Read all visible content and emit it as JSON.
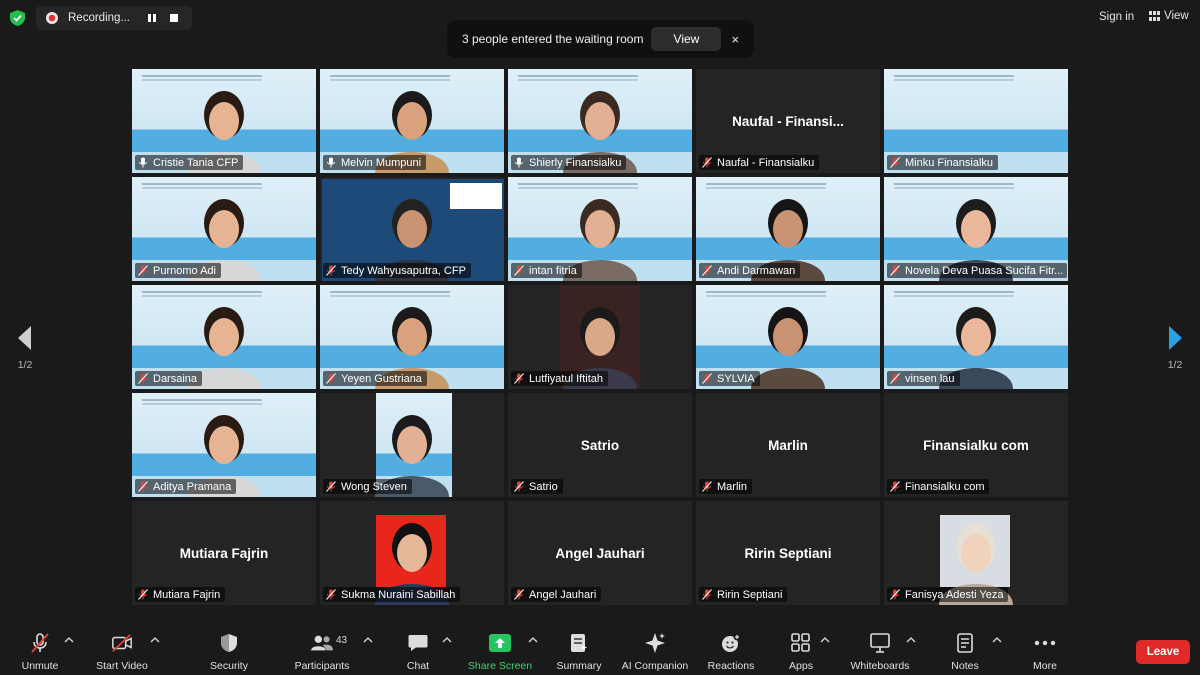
{
  "recording": {
    "label": "Recording..."
  },
  "header": {
    "signin": "Sign in",
    "view": "View"
  },
  "notification": {
    "text": "3 people entered the waiting room",
    "view_button": "View",
    "close": "×"
  },
  "pager": {
    "left": "1/2",
    "right": "1/2"
  },
  "participants": [
    {
      "name": "Cristie Tania CFP",
      "muted": false,
      "video": "slide-person",
      "active": true
    },
    {
      "name": "Melvin Mumpuni",
      "muted": false,
      "video": "slide-person"
    },
    {
      "name": "Shierly Finansialku",
      "muted": false,
      "video": "slide-person"
    },
    {
      "name": "Naufal - Finansialku",
      "muted": true,
      "video": "off",
      "center_name": "Naufal - Finansi..."
    },
    {
      "name": "Minku Finansialku",
      "muted": true,
      "video": "slide"
    },
    {
      "name": "Purnomo Adi",
      "muted": true,
      "video": "slide-person"
    },
    {
      "name": "Tedy Wahyusaputra, CFP",
      "muted": true,
      "video": "fpsb"
    },
    {
      "name": "intan fitria",
      "muted": true,
      "video": "slide-person"
    },
    {
      "name": "Andi Darmawan",
      "muted": true,
      "video": "slide-person"
    },
    {
      "name": "Novela Deva Puasa Sucifa Fitr...",
      "muted": true,
      "video": "slide-avatar"
    },
    {
      "name": "Darsaina",
      "muted": true,
      "video": "slide-avatar"
    },
    {
      "name": "Yeyen Gustriana",
      "muted": true,
      "video": "slide-person"
    },
    {
      "name": "Lutfiyatul Iftitah",
      "muted": true,
      "video": "photo-dark"
    },
    {
      "name": "SYLVIA",
      "muted": true,
      "video": "slide-person"
    },
    {
      "name": "vinsen lau",
      "muted": true,
      "video": "slide-person"
    },
    {
      "name": "Aditya Pramana",
      "muted": true,
      "video": "slide-person"
    },
    {
      "name": "Wong Steven",
      "muted": true,
      "video": "photo-slide"
    },
    {
      "name": "Satrio",
      "muted": true,
      "video": "off",
      "center_name": "Satrio"
    },
    {
      "name": "Marlin",
      "muted": true,
      "video": "off",
      "center_name": "Marlin"
    },
    {
      "name": "Finansialku com",
      "muted": true,
      "video": "off",
      "center_name": "Finansialku com"
    },
    {
      "name": "Mutiara Fajrin",
      "muted": true,
      "video": "off",
      "center_name": "Mutiara Fajrin"
    },
    {
      "name": "Sukma Nuraini Sabillah",
      "muted": true,
      "video": "photo-red"
    },
    {
      "name": "Angel Jauhari",
      "muted": true,
      "video": "off",
      "center_name": "Angel Jauhari"
    },
    {
      "name": "Ririn Septiani",
      "muted": true,
      "video": "off",
      "center_name": "Ririn Septiani"
    },
    {
      "name": "Fanisya Adesti Yeza",
      "muted": true,
      "video": "photo-light"
    }
  ],
  "toolbar": {
    "unmute": "Unmute",
    "start_video": "Start Video",
    "security": "Security",
    "participants": "Participants",
    "participants_count": "43",
    "chat": "Chat",
    "share_screen": "Share Screen",
    "summary": "Summary",
    "ai_companion": "AI Companion",
    "reactions": "Reactions",
    "apps": "Apps",
    "whiteboards": "Whiteboards",
    "notes": "Notes",
    "more": "More",
    "leave": "Leave"
  },
  "colors": {
    "active_speaker": "#c7e54b",
    "share_green": "#3dd679",
    "leave_red": "#e02a2a",
    "muted_red": "#e0413a"
  }
}
